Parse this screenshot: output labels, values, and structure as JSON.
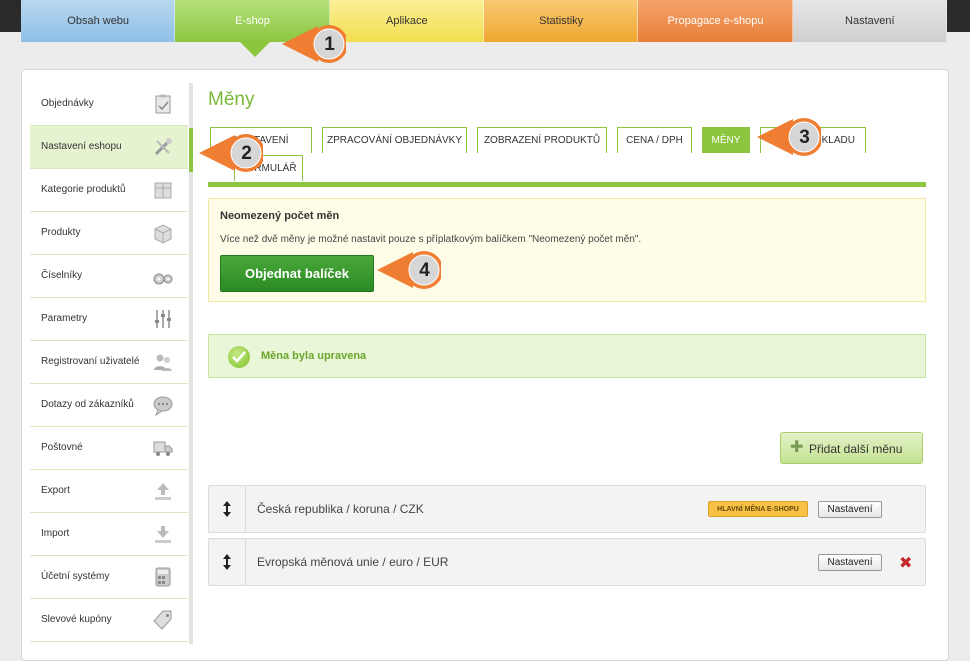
{
  "top_tabs": [
    "Obsah webu",
    "E-shop",
    "Aplikace",
    "Statistiky",
    "Propagace e-shopu",
    "Nastavení"
  ],
  "sidebar": {
    "items": [
      {
        "label": "Objednávky",
        "icon": "clipboard-icon"
      },
      {
        "label": "Nastavení eshopu",
        "icon": "tools-icon",
        "active": true
      },
      {
        "label": "Kategorie produktů",
        "icon": "boxes-icon"
      },
      {
        "label": "Produkty",
        "icon": "box-icon"
      },
      {
        "label": "Číselníky",
        "icon": "gears-icon"
      },
      {
        "label": "Parametry",
        "icon": "sliders-icon"
      },
      {
        "label": "Registrovaní uživatelé",
        "icon": "users-icon"
      },
      {
        "label": "Dotazy od zákazníků",
        "icon": "chat-icon"
      },
      {
        "label": "Poštovné",
        "icon": "truck-icon"
      },
      {
        "label": "Export",
        "icon": "upload-icon"
      },
      {
        "label": "Import",
        "icon": "download-icon"
      },
      {
        "label": "Účetní systémy",
        "icon": "calculator-icon"
      },
      {
        "label": "Slevové kupóny",
        "icon": "tag-icon"
      }
    ]
  },
  "page": {
    "title": "Měny"
  },
  "subtabs": [
    {
      "label": "NASTAVENÍ"
    },
    {
      "label": "ZPRACOVÁNÍ OBJEDNÁVKY"
    },
    {
      "label": "ZOBRAZENÍ PRODUKTŮ"
    },
    {
      "label": "CENA / DPH"
    },
    {
      "label": "MĚNY",
      "active": true
    },
    {
      "label": "KLADU"
    },
    {
      "label": "FORMULÁŘ"
    }
  ],
  "notice": {
    "heading": "Neomezený počet měn",
    "text": "Více než dvě měny je možné nastavit pouze s příplatkovým balíčkem \"Neomezený počet měn\".",
    "button": "Objednat balíček"
  },
  "success": {
    "message": "Měna byla upravena"
  },
  "add_button": "Přidat další měnu",
  "currencies": [
    {
      "name": "Česká republika / koruna / CZK",
      "badge": "HLAVNÍ MĚNA E-SHOPU",
      "settings": "Nastavení"
    },
    {
      "name": "Evropská měnová unie / euro / EUR",
      "settings": "Nastavení"
    }
  ],
  "callouts": [
    "1",
    "2",
    "3",
    "4"
  ],
  "colors": {
    "green": "#8cc63f",
    "callout_orange": "#ef7d32",
    "delete_red": "#c62828"
  }
}
